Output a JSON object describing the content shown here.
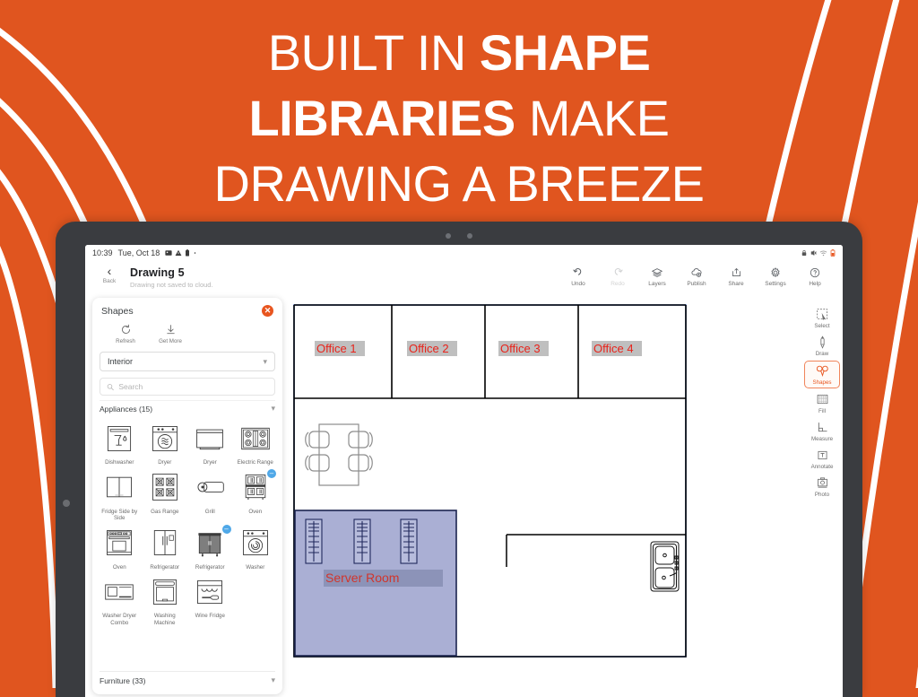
{
  "promo": {
    "headline_line1_normal": "BUILT IN ",
    "headline_line1_bold": "SHAPE",
    "headline_line2_bold": "LIBRARIES",
    "headline_line2_normal": " MAKE",
    "headline_line3": "DRAWING A BREEZE",
    "background_color": "#E0551F",
    "accent_color": "#E8551F"
  },
  "status_bar": {
    "time": "10:39",
    "date": "Tue, Oct 18",
    "left_icons": [
      "screenshot-icon",
      "warning-icon",
      "battery-saver-icon",
      "dot-icon"
    ],
    "right_icons": [
      "lock-icon",
      "silent-icon",
      "wifi-icon",
      "battery-icon"
    ]
  },
  "app_bar": {
    "back_label": "Back",
    "doc_title": "Drawing 5",
    "doc_subtitle": "Drawing not saved to cloud.",
    "tools": [
      {
        "label": "Undo",
        "icon": "undo-icon",
        "dim": false
      },
      {
        "label": "Redo",
        "icon": "redo-icon",
        "dim": true
      },
      {
        "label": "Layers",
        "icon": "layers-icon",
        "dim": false
      },
      {
        "label": "Publish",
        "icon": "publish-cloud-icon",
        "dim": false
      },
      {
        "label": "Share",
        "icon": "share-icon",
        "dim": false
      },
      {
        "label": "Settings",
        "icon": "gear-icon",
        "dim": false
      },
      {
        "label": "Help",
        "icon": "help-icon",
        "dim": false
      }
    ]
  },
  "shapes_panel": {
    "title": "Shapes",
    "close_icon": "close-icon",
    "actions": [
      {
        "label": "Refresh",
        "icon": "refresh-icon"
      },
      {
        "label": "Get More",
        "icon": "download-icon"
      }
    ],
    "library_select": "Interior",
    "search_placeholder": "Search",
    "category_open": "Appliances (15)",
    "category_next": "Furniture (33)",
    "shapes": [
      {
        "label": "Dishwasher",
        "icon": "dishwasher-icon",
        "badge": ""
      },
      {
        "label": "Dryer",
        "icon": "dryer-icon",
        "badge": ""
      },
      {
        "label": "Dryer",
        "icon": "dryer-flat-icon",
        "badge": ""
      },
      {
        "label": "Electric Range",
        "icon": "electric-range-icon",
        "badge": ""
      },
      {
        "label": "Fridge Side by Side",
        "icon": "fridge-side-by-side-icon",
        "badge": ""
      },
      {
        "label": "Gas Range",
        "icon": "gas-range-icon",
        "badge": ""
      },
      {
        "label": "Grill",
        "icon": "grill-icon",
        "badge": ""
      },
      {
        "label": "Oven",
        "icon": "oven-icon",
        "badge": "–"
      },
      {
        "label": "Oven",
        "icon": "oven-range-icon",
        "badge": ""
      },
      {
        "label": "Refrigerator",
        "icon": "refrigerator-icon",
        "badge": ""
      },
      {
        "label": "Refrigerator",
        "icon": "refrigerator-filled-icon",
        "badge": "–"
      },
      {
        "label": "Washer",
        "icon": "washer-icon",
        "badge": ""
      },
      {
        "label": "Washer Dryer Combo",
        "icon": "washer-dryer-combo-icon",
        "badge": ""
      },
      {
        "label": "Washing Machine",
        "icon": "washing-machine-icon",
        "badge": ""
      },
      {
        "label": "Wine Fridge",
        "icon": "wine-fridge-icon",
        "badge": ""
      }
    ]
  },
  "tool_rail": [
    {
      "label": "Select",
      "icon": "select-icon",
      "active": false
    },
    {
      "label": "Draw",
      "icon": "draw-pen-icon",
      "active": false
    },
    {
      "label": "Shapes",
      "icon": "shapes-icon",
      "active": true
    },
    {
      "label": "Fill",
      "icon": "fill-icon",
      "active": false
    },
    {
      "label": "Measure",
      "icon": "measure-icon",
      "active": false
    },
    {
      "label": "Annotate",
      "icon": "annotate-icon",
      "active": false
    },
    {
      "label": "Photo",
      "icon": "photo-icon",
      "active": false
    }
  ],
  "canvas": {
    "selection_color": "#3366CC",
    "wall_color": "#000000",
    "room_labels": [
      {
        "text": "Office 1",
        "text_color": "#E8231B",
        "bg_color": "#BFBFBF"
      },
      {
        "text": "Office 2",
        "text_color": "#E8231B",
        "bg_color": "#BFBFBF"
      },
      {
        "text": "Office 3",
        "text_color": "#E8231B",
        "bg_color": "#BFBFBF"
      },
      {
        "text": "Office 4",
        "text_color": "#E8231B",
        "bg_color": "#BFBFBF"
      },
      {
        "text": "Server Room",
        "text_color": "#D1352C",
        "bg_color": "#8C93B8"
      }
    ],
    "server_room_fill": "#AAAFD4",
    "objects": [
      "conference-table-4-chairs",
      "server-rack",
      "server-rack",
      "server-rack",
      "double-sink"
    ]
  }
}
